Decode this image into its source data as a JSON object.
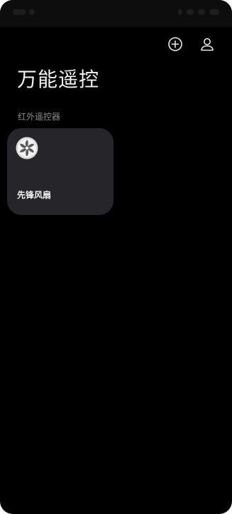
{
  "header": {
    "title": "万能遥控"
  },
  "toolbar": {
    "add_icon": "plus-circle-icon",
    "account_icon": "person-icon"
  },
  "section": {
    "label": "红外遥控器"
  },
  "devices": [
    {
      "name": "先锋风扇",
      "icon": "fan-icon"
    }
  ],
  "colors": {
    "background": "#000000",
    "card": "#26262a",
    "title_text": "#f2f2f2",
    "section_text": "#8a8a8a"
  }
}
